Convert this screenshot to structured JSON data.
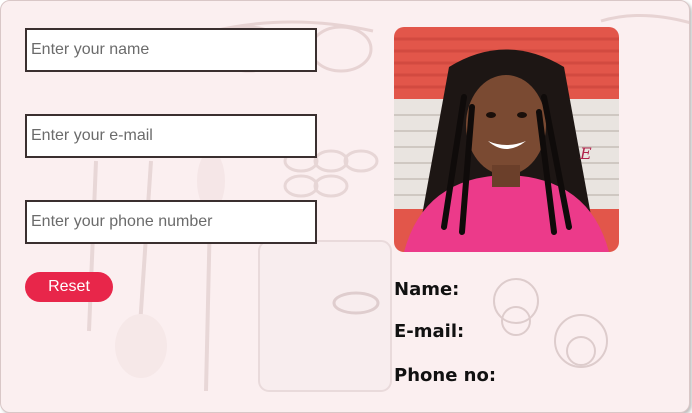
{
  "form": {
    "name_placeholder": "Enter your name",
    "email_placeholder": "Enter your e-mail",
    "phone_placeholder": "Enter your phone number",
    "reset_label": "Reset"
  },
  "profile": {
    "name_label": "Name:",
    "email_label": "E-mail:",
    "phone_label": "Phone no:",
    "photo_watermark": "E"
  },
  "colors": {
    "accent": "#e8264a",
    "card_background": "#fbeff0",
    "photo_backdrop": "#e2564a",
    "shirt": "#ec3a8a"
  }
}
